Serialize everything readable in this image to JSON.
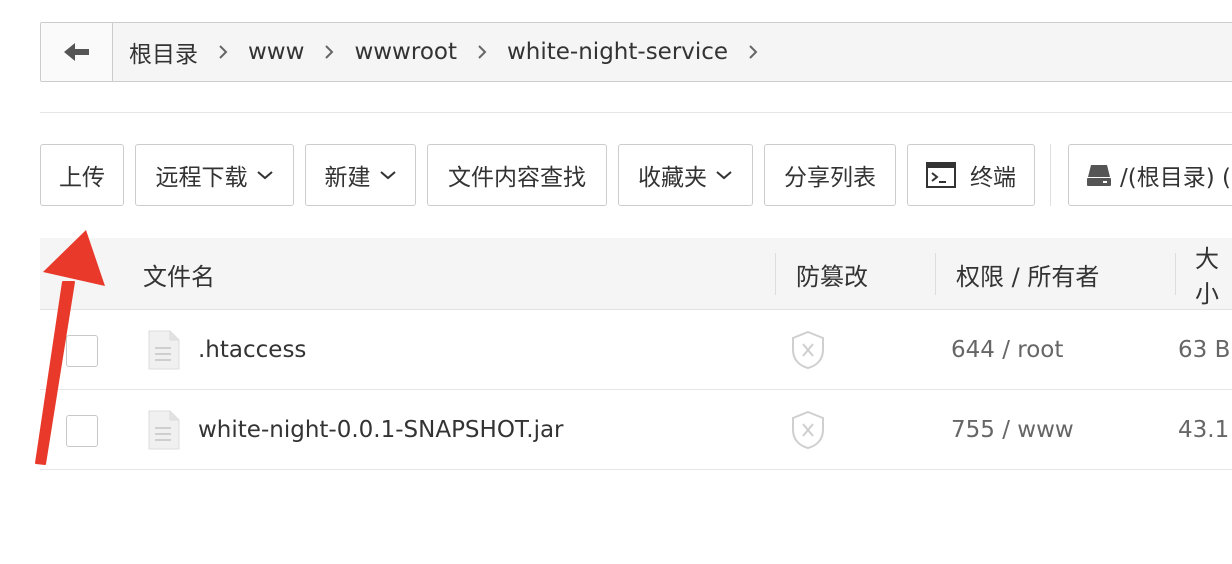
{
  "breadcrumb": {
    "items": [
      "根目录",
      "www",
      "wwwroot",
      "white-night-service"
    ]
  },
  "toolbar": {
    "upload": "上传",
    "remote_download": "远程下载",
    "new": "新建",
    "content_search": "文件内容查找",
    "favorites": "收藏夹",
    "share_list": "分享列表",
    "terminal": "终端",
    "disk": "/(根目录) ("
  },
  "table": {
    "headers": {
      "filename": "文件名",
      "tamper": "防篡改",
      "perm_owner": "权限 / 所有者",
      "size": "大小"
    },
    "rows": [
      {
        "name": ".htaccess",
        "perm": "644 / root",
        "size": "63 B"
      },
      {
        "name": "white-night-0.0.1-SNAPSHOT.jar",
        "perm": "755 / www",
        "size": "43.1"
      }
    ]
  },
  "colors": {
    "annotation_arrow": "#e8392a",
    "border": "#cccccc",
    "header_bg": "#f5f5f5"
  },
  "icons": [
    "back-arrow-icon",
    "chevron-right-icon",
    "chevron-down-icon",
    "terminal-icon",
    "disk-icon",
    "file-icon",
    "shield-icon"
  ]
}
